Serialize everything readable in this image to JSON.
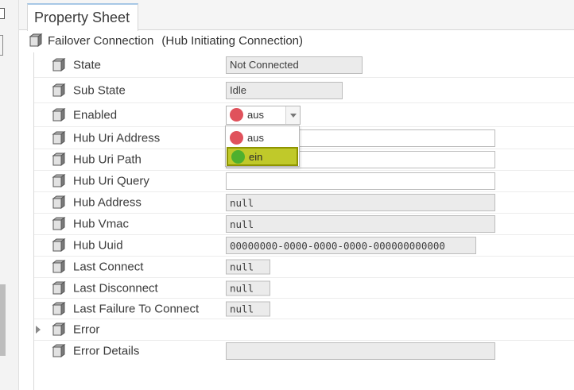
{
  "tab": {
    "label": "Property Sheet"
  },
  "root": {
    "name": "Failover Connection",
    "type_label": "(Hub Initiating Connection)"
  },
  "properties": [
    {
      "label": "State",
      "value": "Not Connected"
    },
    {
      "label": "Sub State",
      "value": "Idle"
    },
    {
      "label": "Enabled",
      "value": "aus"
    },
    {
      "label": "Hub Uri Address",
      "value": ""
    },
    {
      "label": "Hub Uri Path",
      "value": ""
    },
    {
      "label": "Hub Uri Query",
      "value": ""
    },
    {
      "label": "Hub Address",
      "value": "null"
    },
    {
      "label": "Hub Vmac",
      "value": "null"
    },
    {
      "label": "Hub Uuid",
      "value": "00000000-0000-0000-0000-000000000000"
    },
    {
      "label": "Last Connect",
      "value": "null"
    },
    {
      "label": "Last Disconnect",
      "value": "null"
    },
    {
      "label": "Last Failure To Connect",
      "value": "null"
    },
    {
      "label": "Error",
      "value": ""
    },
    {
      "label": "Error Details",
      "value": ""
    }
  ],
  "enabled_dropdown": {
    "selected": "aus",
    "options": [
      {
        "label": "aus",
        "color": "#e0525c"
      },
      {
        "label": "ein",
        "color": "#4fb02e"
      }
    ],
    "highlighted": "ein"
  },
  "icons": {
    "property": "component-cube-icon",
    "expander": "expand-triangle-icon",
    "dropdown": "chevron-down-icon"
  },
  "colors": {
    "highlight": "#c0c92a",
    "off": "#e0525c",
    "on": "#4fb02e",
    "tab_accent": "#a8c8e6"
  }
}
